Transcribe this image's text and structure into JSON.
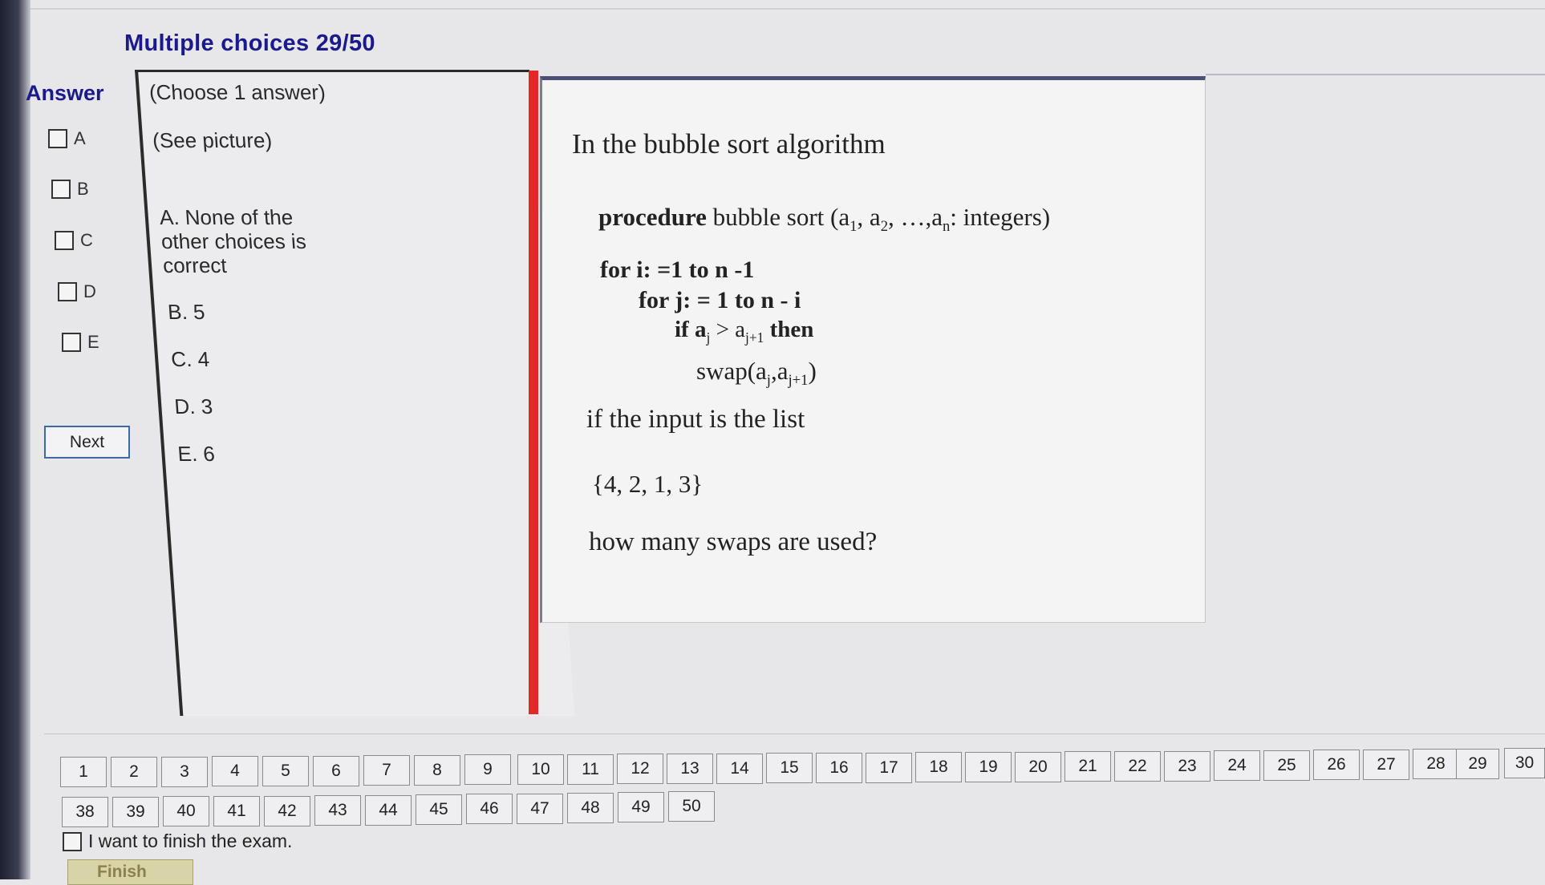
{
  "header": {
    "title": "Multiple choices 29/50"
  },
  "answer": {
    "heading": "Answer",
    "options": [
      "A",
      "B",
      "C",
      "D",
      "E"
    ],
    "next_label": "Next"
  },
  "choices": {
    "instruction": "(Choose 1 answer)",
    "see_picture": "(See picture)",
    "items": [
      "A. None of the",
      "other choices is",
      "correct",
      "B. 5",
      "C. 4",
      "D. 3",
      "E. 6"
    ]
  },
  "picture": {
    "title": "In the bubble sort algorithm",
    "proc_kw": "procedure",
    "proc_rest": " bubble sort (a",
    "proc_s1": "1",
    "proc_mid1": ", a",
    "proc_s2": "2",
    "proc_mid2": ", …,a",
    "proc_sn": "n",
    "proc_end": ": integers)",
    "line_for_i": "for i: =1 to n -1",
    "line_for_j": "for j: = 1 to n - i",
    "if_kw": "if a",
    "if_sj": "j",
    "if_gt": " > a",
    "if_sj1": "j+1",
    "if_then": " then",
    "swap_a": "swap(a",
    "swap_sj": "j",
    "swap_b": ",a",
    "swap_sj1": "j+1",
    "swap_c": ")",
    "input_text": "if the input is the list",
    "list_text": "{4, 2, 1, 3}",
    "question": "how many swaps are used?"
  },
  "navigation": {
    "row1": [
      "1",
      "2",
      "3",
      "4",
      "5",
      "6",
      "7",
      "8",
      "9",
      "10",
      "11",
      "12",
      "13",
      "14",
      "15",
      "16",
      "17",
      "18",
      "19",
      "20",
      "21",
      "22",
      "23",
      "24",
      "25",
      "26",
      "27",
      "28",
      "29",
      "30"
    ],
    "row2": [
      "38",
      "39",
      "40",
      "41",
      "42",
      "43",
      "44",
      "45",
      "46",
      "47",
      "48",
      "49",
      "50"
    ]
  },
  "finish": {
    "checkbox_label": "I want to finish the exam.",
    "button_label": "Finish"
  }
}
